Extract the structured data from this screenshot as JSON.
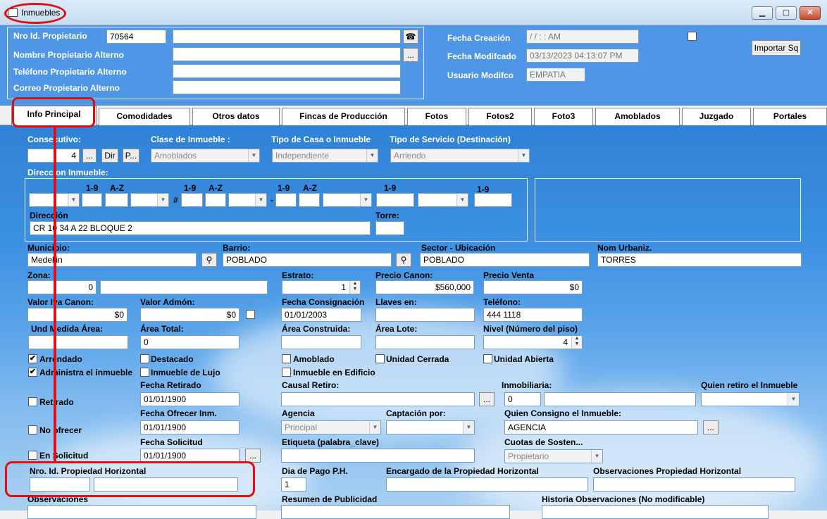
{
  "window": {
    "title": "Inmuebles",
    "min": "▁",
    "max": "▢",
    "close": "✕"
  },
  "header": {
    "nro_label": "Nro Id. Propietario",
    "nro_value": "70564",
    "nombre_label": "Nombre Propietario Alterno",
    "telefono_label": "Teléfono Propietario Alterno",
    "correo_label": "Correo Propietario Alterno",
    "fecha_creacion_label": "Fecha Creación",
    "fecha_creacion_value": " / /       :  :   AM",
    "fecha_mod_label": "Fecha Modifcado",
    "fecha_mod_value": "03/13/2023 04:13:07 PM",
    "usuario_label": "Usuario Modifco",
    "usuario_value": "EMPATIA",
    "importar_label": "Importar Sq",
    "dots": "...",
    "phone_icon": "☎"
  },
  "tabs": [
    "Info Principal",
    "Comodidades",
    "Otros datos",
    "Fincas de Producción",
    "Fotos",
    "Fotos2",
    "Foto3",
    "Amoblados",
    "Juzgado",
    "Portales"
  ],
  "form": {
    "consecutivo_label": "Consecutivo:",
    "consecutivo_value": "4",
    "dots": "...",
    "dir_btn": "Dir",
    "p_btn": "P...",
    "clase_label": "Clase de Inmueble :",
    "clase_value": "Amoblados",
    "tipo_casa_label": "Tipo de Casa o Inmueble",
    "tipo_casa_value": "Independiente",
    "tipo_servicio_label": "Tipo de Servicio (Destinación)",
    "tipo_servicio_value": "Arriendo",
    "direccion_inmueble_label": "Direccion Inmueble:",
    "h19": "1-9",
    "haz": "A-Z",
    "hash": "#",
    "dash": "-",
    "direccion_label": "Dirección",
    "direccion_value": "CR 10 34 A 22 BLOQUE 2",
    "torre_label": "Torre:",
    "municipio_label": "Municipio:",
    "municipio_value": "Medellin",
    "barrio_label": "Barrio:",
    "barrio_value": "POBLADO",
    "sector_label": "Sector - Ubicación",
    "sector_value": "POBLADO",
    "urbaniz_label": "Nom Urbaniz.",
    "urbaniz_value": "TORRES",
    "zona_label": "Zona:",
    "zona_value": "0",
    "estrato_label": "Estrato:",
    "estrato_value": "1",
    "canon_label": "Precio Canon:",
    "canon_value": "$560,000",
    "venta_label": "Precio Venta",
    "venta_value": "$0",
    "iva_label": "Valor Iva Canon:",
    "iva_value": "$0",
    "admon_label": "Valor Admón:",
    "admon_value": "$0",
    "fconsig_label": "Fecha Consignación",
    "fconsig_value": "01/01/2003",
    "llaves_label": "Llaves en:",
    "telefono_label": "Teléfono:",
    "telefono_value": "444 1118",
    "und_label": "Und Medida Área:",
    "area_total_label": "Área Total:",
    "area_total_value": "0",
    "area_const_label": "Área Construida:",
    "area_lote_label": "Área Lote:",
    "nivel_label": "Nivel (Número del piso)",
    "nivel_value": "4",
    "arrendado": "Arrendado",
    "destacado": "Destacado",
    "amoblado": "Amoblado",
    "unidad_cerrada": "Unidad Cerrada",
    "unidad_abierta": "Unidad Abierta",
    "administra": "Administra el inmueble",
    "lujo": "Inmueble de Lujo",
    "edificio": "Inmueble en Edificio",
    "fretirado_label": "Fecha Retirado",
    "fretirado_value": "01/01/1900",
    "causal_label": "Causal Retiro:",
    "inmobiliaria_label": "Inmobiliaria:",
    "inmobiliaria_value": "0",
    "quien_retiro_label": "Quien retiro el Inmueble",
    "retirado": "Retirado",
    "fofrecer_label": "Fecha Ofrecer Inm.",
    "fofrecer_value": "01/01/1900",
    "agencia_label": "Agencia",
    "agencia_value": "Principal",
    "captacion_label": "Captación por:",
    "quien_consigno_label": "Quien Consigno el Inmueble:",
    "quien_consigno_value": "AGENCIA",
    "no_ofrecer": "No ofrecer",
    "fsolicitud_label": "Fecha Solicitud",
    "fsolicitud_value": "01/01/1900",
    "etiqueta_label": "Etiqueta (palabra_clave)",
    "cuotas_label": "Cuotas de Sosten...",
    "cuotas_value": "Propietario",
    "en_solicitud": "En Solicitud",
    "nro_ph_label": "Nro. Id. Propiedad Horizontal",
    "dia_pago_label": "Dia de Pago P.H.",
    "dia_pago_value": "1",
    "encargado_label": "Encargado de la Propiedad Horizontal",
    "obs_ph_label": "Observaciones Propiedad Horizontal",
    "observaciones_label": "Observaciones",
    "resumen_label": "Resumen de Publicidad",
    "historia_label": "Historia Observaciones (No modificable)"
  },
  "checks": {
    "arrendado": "✔",
    "administra": "✔"
  }
}
